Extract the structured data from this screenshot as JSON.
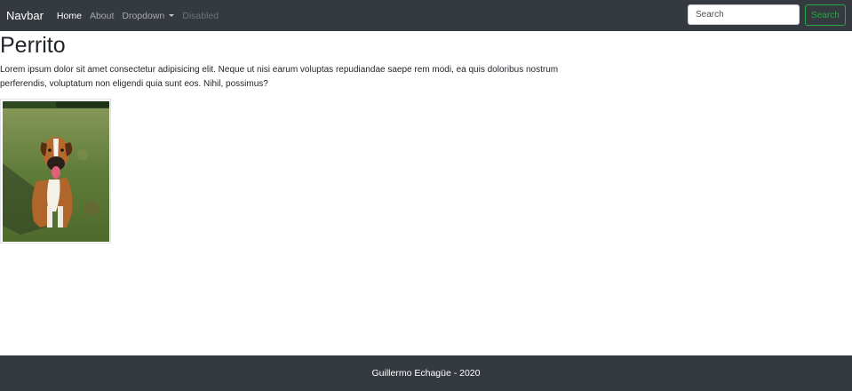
{
  "navbar": {
    "brand": "Navbar",
    "links": [
      {
        "label": "Home",
        "state": "active"
      },
      {
        "label": "About",
        "state": "normal"
      },
      {
        "label": "Dropdown",
        "state": "dropdown"
      },
      {
        "label": "Disabled",
        "state": "disabled"
      }
    ],
    "search_placeholder": "Search",
    "search_button": "Search"
  },
  "main": {
    "title": "Perrito",
    "text": "Lorem ipsum dolor sit amet consectetur adipisicing elit. Neque ut nisi earum voluptas repudiandae saepe rem modi, ea quis doloribus nostrum perferendis, voluptatum non eligendi quia sunt eos. Nihil, possimus?"
  },
  "footer": {
    "text": "Guillermo Echagüe - 2020"
  },
  "colors": {
    "navbar_bg": "#343a40",
    "accent_success": "#28a745"
  }
}
